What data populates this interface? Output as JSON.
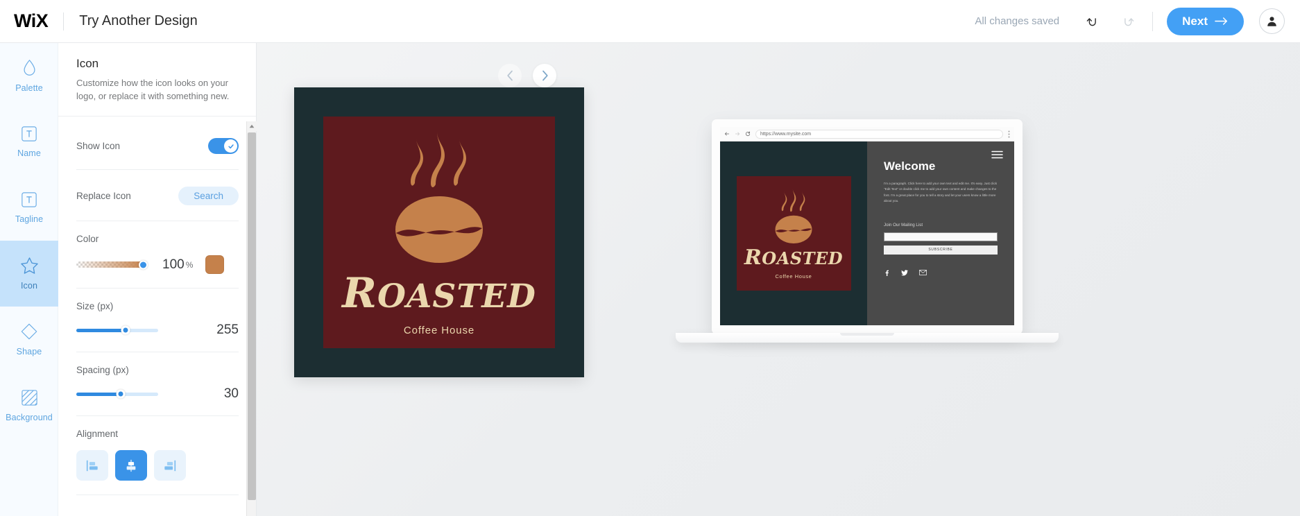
{
  "topbar": {
    "logo_text": "WiX",
    "title": "Try Another Design",
    "save_status": "All changes saved",
    "undo_label": "Undo",
    "redo_label": "Redo",
    "next_label": "Next",
    "account_label": "Account"
  },
  "sidebar": {
    "items": [
      {
        "label": "Palette",
        "icon": "droplet-icon",
        "active": false
      },
      {
        "label": "Name",
        "icon": "text-box-icon",
        "active": false
      },
      {
        "label": "Tagline",
        "icon": "text-box-icon",
        "active": false
      },
      {
        "label": "Icon",
        "icon": "star-icon",
        "active": true
      },
      {
        "label": "Shape",
        "icon": "diamond-icon",
        "active": false
      },
      {
        "label": "Background",
        "icon": "hatched-square-icon",
        "active": false
      }
    ]
  },
  "panel": {
    "title": "Icon",
    "description": "Customize how the icon looks on your logo, or replace it with something new.",
    "show_icon": {
      "label": "Show Icon",
      "value": "on"
    },
    "replace_icon": {
      "label": "Replace Icon",
      "button": "Search"
    },
    "color": {
      "label": "Color",
      "opacity_value": "100",
      "opacity_unit": "%",
      "swatch_hex": "#C5814B"
    },
    "size": {
      "label": "Size (px)",
      "value": "255",
      "fill_percent": 60
    },
    "spacing": {
      "label": "Spacing (px)",
      "value": "30",
      "fill_percent": 54
    },
    "alignment": {
      "label": "Alignment",
      "options": [
        "left",
        "center",
        "right"
      ],
      "selected": "center"
    }
  },
  "canvas": {
    "prev_label": "Previous design",
    "next_label": "Next design",
    "logo": {
      "frame_hex": "#1C2E32",
      "panel_hex": "#5E1A1E",
      "icon_hex": "#C5814B",
      "text_hex": "#EBD7AD",
      "name_first": "R",
      "name_rest": "OASTED",
      "tagline": "Coffee House"
    },
    "mockup": {
      "url": "https://www.mysite.com",
      "heading": "Welcome",
      "paragraph": "I'm a paragraph. Click here to add your own text and edit me. It's easy. Just click \"Edit Text\" or double click me to add your own content and make changes to the font. I'm a great place for you to tell a story and let your users know a little more about you.",
      "mailing_label": "Join Our Mailing List",
      "email_placeholder": "",
      "subscribe_label": "SUBSCRIBE",
      "social": [
        "facebook-icon",
        "twitter-icon",
        "email-icon"
      ],
      "left_bg_hex": "#1C2E32",
      "right_bg_hex": "#4A4A4A"
    }
  }
}
